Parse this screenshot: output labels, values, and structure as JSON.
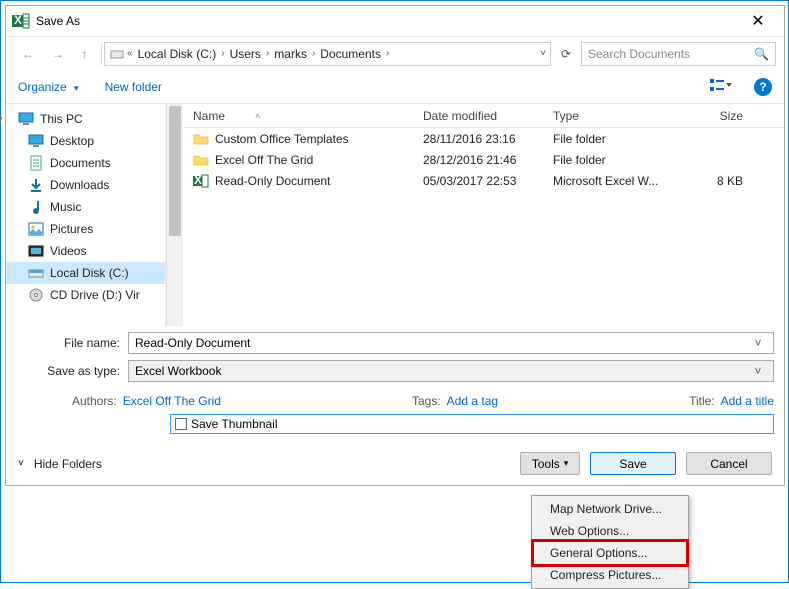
{
  "title": "Save As",
  "nav": {
    "breadcrumb": [
      "Local Disk (C:)",
      "Users",
      "marks",
      "Documents"
    ],
    "search_placeholder": "Search Documents"
  },
  "toolbar": {
    "organize": "Organize",
    "new_folder": "New folder"
  },
  "tree": {
    "pc": "This PC",
    "items": [
      {
        "label": "Desktop",
        "icon": "desktop"
      },
      {
        "label": "Documents",
        "icon": "doc"
      },
      {
        "label": "Downloads",
        "icon": "download"
      },
      {
        "label": "Music",
        "icon": "music"
      },
      {
        "label": "Pictures",
        "icon": "pictures"
      },
      {
        "label": "Videos",
        "icon": "videos"
      },
      {
        "label": "Local Disk (C:)",
        "icon": "disk",
        "selected": true
      },
      {
        "label": "CD Drive (D:) Vir",
        "icon": "cd"
      }
    ]
  },
  "columns": {
    "name": "Name",
    "date": "Date modified",
    "type": "Type",
    "size": "Size"
  },
  "files": [
    {
      "name": "Custom Office Templates",
      "date": "28/11/2016 23:16",
      "type": "File folder",
      "size": "",
      "icon": "folder"
    },
    {
      "name": "Excel Off The Grid",
      "date": "28/12/2016 21:46",
      "type": "File folder",
      "size": "",
      "icon": "folder"
    },
    {
      "name": "Read-Only Document",
      "date": "05/03/2017 22:53",
      "type": "Microsoft Excel W...",
      "size": "8 KB",
      "icon": "excel"
    }
  ],
  "form": {
    "filename_label": "File name:",
    "filename_value": "Read-Only Document",
    "saveas_label": "Save as type:",
    "saveas_value": "Excel Workbook",
    "authors_label": "Authors:",
    "authors_value": "Excel Off The Grid",
    "tags_label": "Tags:",
    "tags_value": "Add a tag",
    "title_label": "Title:",
    "title_value": "Add a title",
    "save_thumbnail": "Save Thumbnail"
  },
  "footer": {
    "hide": "Hide Folders",
    "tools": "Tools",
    "save": "Save",
    "cancel": "Cancel"
  },
  "menu": {
    "items": [
      "Map Network Drive...",
      "Web Options...",
      "General Options...",
      "Compress Pictures..."
    ],
    "highlight_index": 2
  }
}
